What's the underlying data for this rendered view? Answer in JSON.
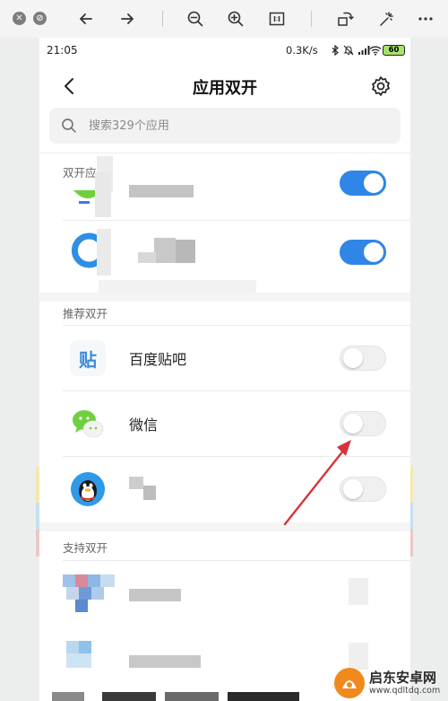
{
  "status_bar": {
    "time": "21:05",
    "net_speed": "0.3K/s",
    "battery": "60",
    "icons": [
      "bluetooth-icon",
      "mute-icon",
      "signal-icon",
      "wifi-icon",
      "battery-icon"
    ]
  },
  "header": {
    "title": "应用双开",
    "back_icon": "chevron-left-icon",
    "settings_icon": "gear-icon"
  },
  "search": {
    "placeholder": "搜索329个应用",
    "value": ""
  },
  "sections": {
    "enabled": {
      "label": "双开应"
    },
    "recommended": {
      "label": "推荐双开",
      "apps": [
        {
          "name": "百度贴吧",
          "enabled": false,
          "icon_text": "贴"
        },
        {
          "name": "微信",
          "enabled": false
        },
        {
          "name": "",
          "enabled": false
        }
      ]
    },
    "supported": {
      "label": "支持双开"
    }
  },
  "enabled_apps": [
    {
      "name": "",
      "enabled": true
    },
    {
      "name": "",
      "enabled": true
    }
  ],
  "viewer": {
    "zoom_out_icon": "zoom-out-icon",
    "zoom_in_icon": "zoom-in-icon",
    "rotate_icon": "rotate-icon",
    "more_icon": "more-icon"
  },
  "watermark": {
    "brand": "启东安卓网",
    "url": "www.qdltdq.com"
  },
  "colors": {
    "toggle_on": "#2f86e6",
    "toggle_off": "#f0f0f0",
    "wechat_green": "#6fd03f",
    "battery_fill": "#a8e26a"
  }
}
